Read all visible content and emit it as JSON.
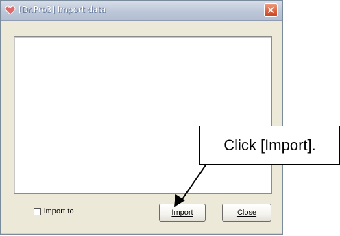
{
  "window": {
    "title": "[Dr.Pro3] Import data",
    "close_glyph": "✕"
  },
  "panel": {
    "content": ""
  },
  "options": {
    "import_to_label": "import to",
    "import_to_checked": false
  },
  "buttons": {
    "import_label": "Import",
    "close_label": "Close"
  },
  "callout": {
    "text": "Click [Import]."
  },
  "colors": {
    "titlebar": "#bcc7d8",
    "dialog_bg": "#ece9d8",
    "close_button": "#d85f3c"
  }
}
